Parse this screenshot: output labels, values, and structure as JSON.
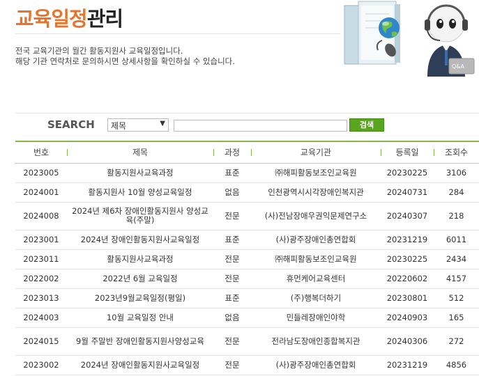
{
  "header": {
    "title_accent": "교육일정",
    "title_rest": "관리",
    "desc_line1": "전국 교육기관의 월간 활동지원사 교육일정입니다.",
    "desc_line2": "해당 기관 연락처로 문의하시면 상세사항을 확인하실 수 있습니다."
  },
  "illustration": {
    "tag": "Q&A"
  },
  "search": {
    "label": "SEARCH",
    "select_value": "제목",
    "input_value": "",
    "button_label": "검색"
  },
  "table": {
    "headers": [
      "번호",
      "제목",
      "과정",
      "교육기관",
      "등록일",
      "조회수"
    ],
    "rows": [
      [
        "2023005",
        "활동지원사교육과정",
        "표준",
        "㈜해피활동보조인교육원",
        "20230225",
        "3106"
      ],
      [
        "2024001",
        "활동지원사 10월 양성교육일정",
        "없음",
        "인천광역시시각장애인복지관",
        "20240731",
        "284"
      ],
      [
        "2024008",
        "2024년 제6차 장애인활동지원사 양성교육(주말)",
        "전문",
        "(사)전남장애우권익문제연구소",
        "20240307",
        "218"
      ],
      [
        "2023001",
        "2024년 장애인활동지원사교육일정",
        "표준",
        "(사)광주장애인총연합회",
        "20231219",
        "6011"
      ],
      [
        "2023011",
        "활동지원사교육과정",
        "전문",
        "㈜해피활동보조인교육원",
        "20230225",
        "2434"
      ],
      [
        "2022002",
        "2022년 6월 교육일정",
        "전문",
        "휴먼케어교육센터",
        "20220602",
        "4157"
      ],
      [
        "2023013",
        "2023년9월교육일정(평일)",
        "표준",
        "(주)행복더하기",
        "20230801",
        "512"
      ],
      [
        "2024003",
        "10월 교육일정 안내",
        "없음",
        "민들레장애인야학",
        "20240903",
        "165"
      ],
      [
        "2024015",
        "9월 주말반 장애인활동지원사양성교육",
        "전문",
        "전라남도장애인종합복지관",
        "20240306",
        "272"
      ],
      [
        "2023002",
        "2024년 장애인활동지원사교육일정",
        "전문",
        "(사)광주장애인총연합회",
        "20231219",
        "4856"
      ]
    ]
  }
}
